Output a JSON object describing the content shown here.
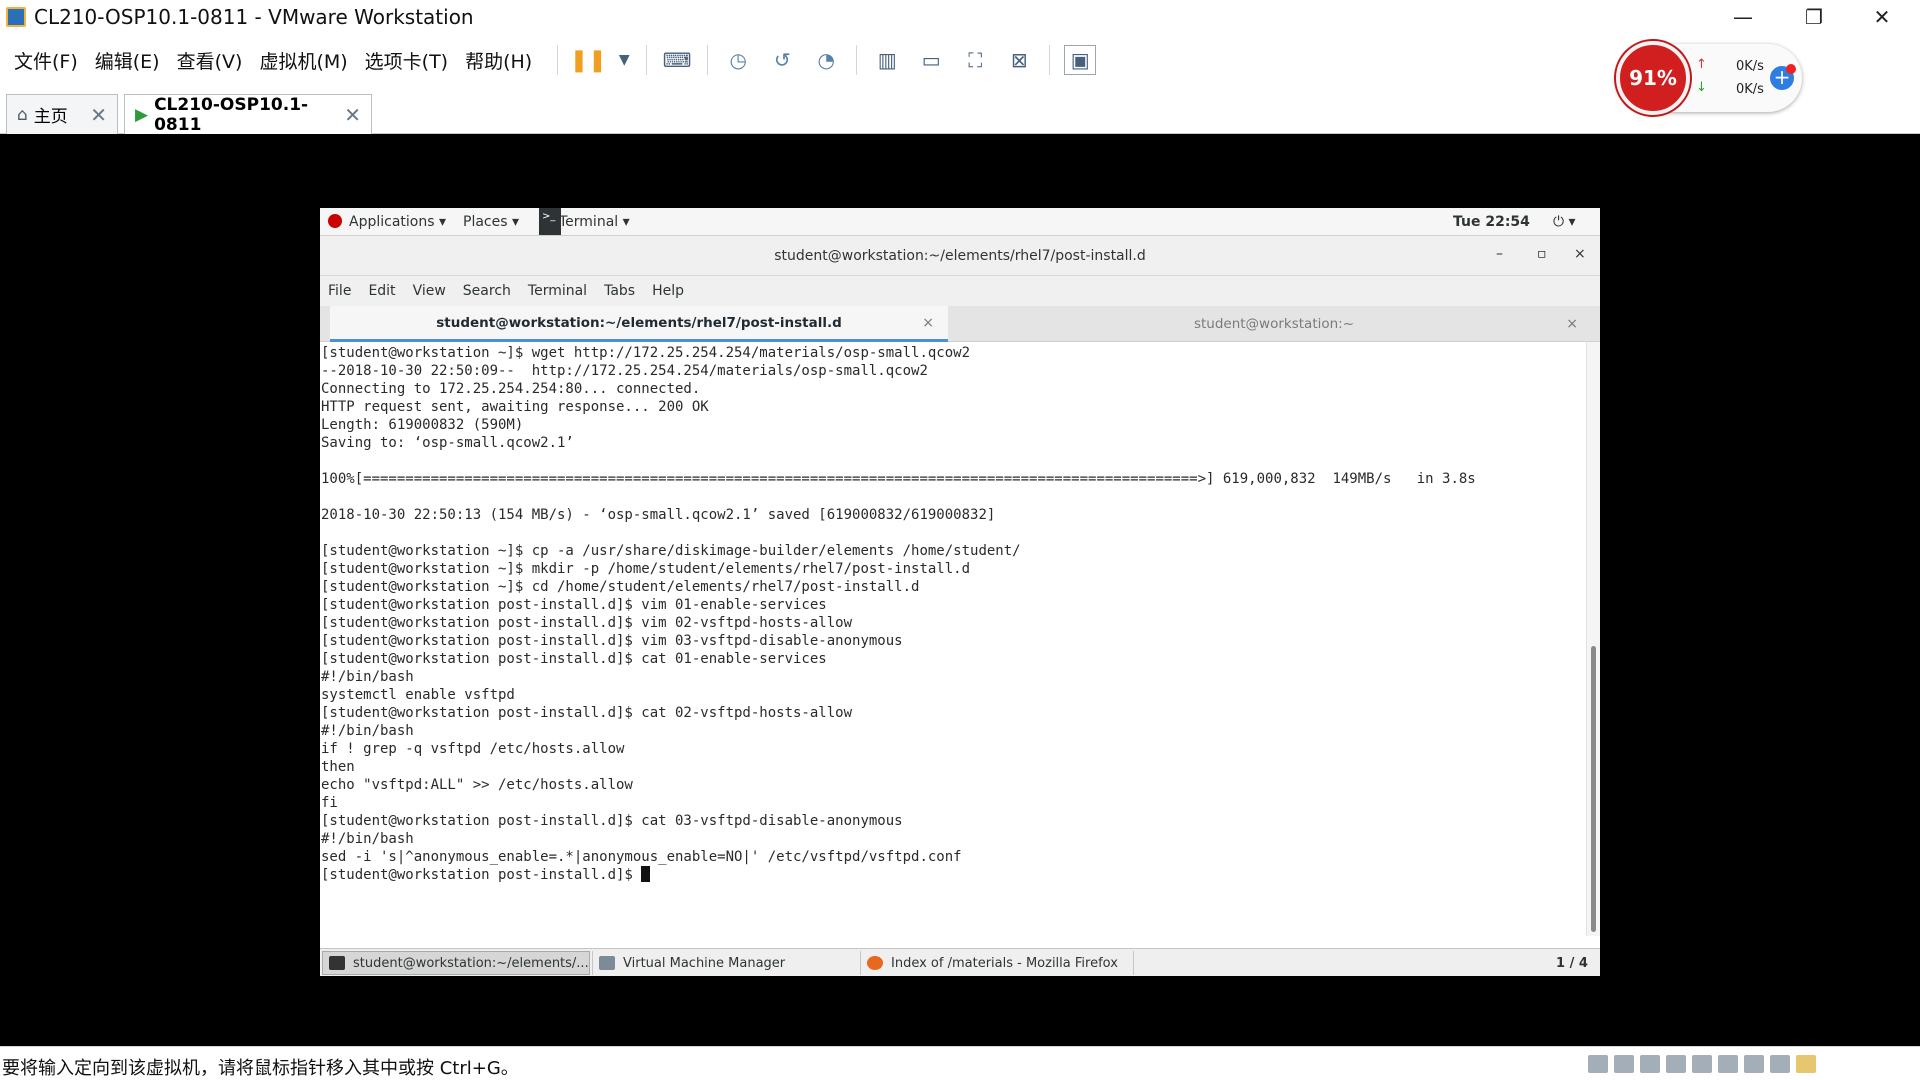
{
  "host": {
    "window_title": "CL210-OSP10.1-0811 - VMware Workstation",
    "controls": {
      "minimize": "—",
      "restore": "❐",
      "close": "✕"
    },
    "menu": [
      "文件(F)",
      "编辑(E)",
      "查看(V)",
      "虚拟机(M)",
      "选项卡(T)",
      "帮助(H)"
    ],
    "tabs": [
      {
        "label": "主页",
        "close": "✕"
      },
      {
        "label": "CL210-OSP10.1-0811",
        "close": "✕"
      }
    ],
    "net_widget": {
      "cpu": "91%",
      "up": "0K/s",
      "down": "0K/s",
      "up_arrow": "↑",
      "down_arrow": "↓",
      "plus": "+"
    },
    "status_text": "要将输入定向到该虚拟机，请将鼠标指针移入其中或按 Ctrl+G。"
  },
  "guest": {
    "panel": {
      "applications": "Applications ▾",
      "places": "Places ▾",
      "terminal_icon": ">_",
      "terminal": "Terminal ▾",
      "clock": "Tue 22:54",
      "power": "⏻ ▾"
    },
    "terminal": {
      "title": "student@workstation:~/elements/rhel7/post-install.d",
      "controls": {
        "min": "–",
        "max": "▫",
        "close": "×"
      },
      "menu": [
        "File",
        "Edit",
        "View",
        "Search",
        "Terminal",
        "Tabs",
        "Help"
      ],
      "tabs": [
        {
          "label": "student@workstation:~/elements/rhel7/post-install.d",
          "close": "×"
        },
        {
          "label": "student@workstation:~",
          "close": "×"
        }
      ],
      "lines": [
        "[student@workstation ~]$ wget http://172.25.254.254/materials/osp-small.qcow2",
        "--2018-10-30 22:50:09--  http://172.25.254.254/materials/osp-small.qcow2",
        "Connecting to 172.25.254.254:80... connected.",
        "HTTP request sent, awaiting response... 200 OK",
        "Length: 619000832 (590M)",
        "Saving to: ‘osp-small.qcow2.1’",
        "",
        "100%[===================================================================================================>] 619,000,832  149MB/s   in 3.8s",
        "",
        "2018-10-30 22:50:13 (154 MB/s) - ‘osp-small.qcow2.1’ saved [619000832/619000832]",
        "",
        "[student@workstation ~]$ cp -a /usr/share/diskimage-builder/elements /home/student/",
        "[student@workstation ~]$ mkdir -p /home/student/elements/rhel7/post-install.d",
        "[student@workstation ~]$ cd /home/student/elements/rhel7/post-install.d",
        "[student@workstation post-install.d]$ vim 01-enable-services",
        "[student@workstation post-install.d]$ vim 02-vsftpd-hosts-allow",
        "[student@workstation post-install.d]$ vim 03-vsftpd-disable-anonymous",
        "[student@workstation post-install.d]$ cat 01-enable-services",
        "#!/bin/bash",
        "systemctl enable vsftpd",
        "[student@workstation post-install.d]$ cat 02-vsftpd-hosts-allow",
        "#!/bin/bash",
        "if ! grep -q vsftpd /etc/hosts.allow",
        "then",
        "echo \"vsftpd:ALL\" >> /etc/hosts.allow",
        "fi",
        "[student@workstation post-install.d]$ cat 03-vsftpd-disable-anonymous",
        "#!/bin/bash",
        "sed -i 's|^anonymous_enable=.*|anonymous_enable=NO|' /etc/vsftpd/vsftpd.conf"
      ],
      "prompt": "[student@workstation post-install.d]$ "
    },
    "taskbar": {
      "terminal": "student@workstation:~/elements/...",
      "vmm": "Virtual Machine Manager",
      "firefox": "Index of /materials - Mozilla Firefox",
      "workspace": "1 / 4"
    }
  }
}
